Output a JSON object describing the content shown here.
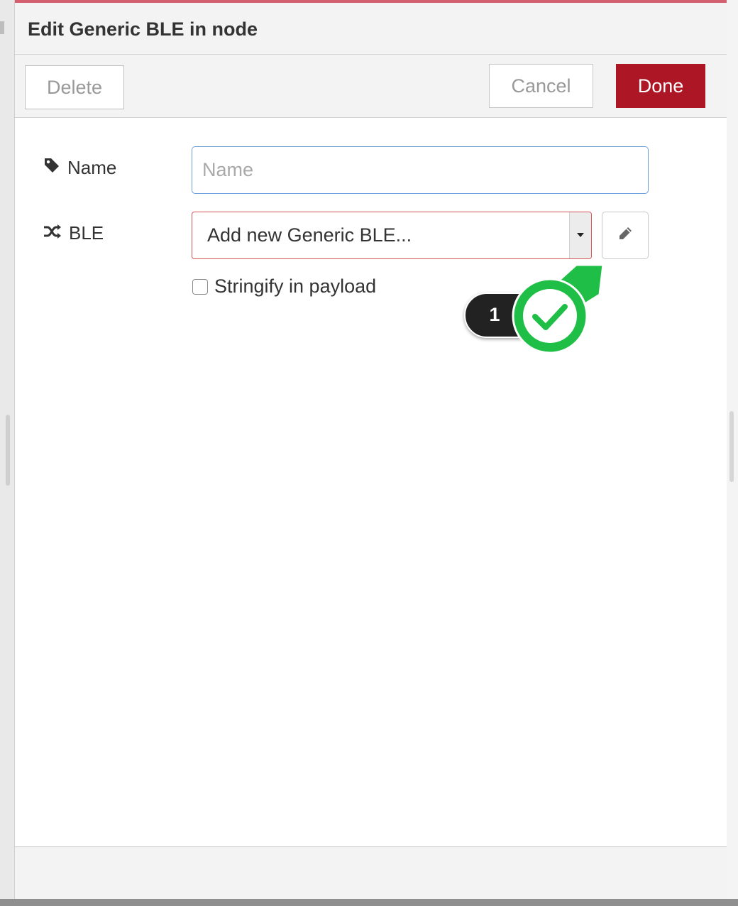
{
  "dialog": {
    "title": "Edit Generic BLE in node"
  },
  "toolbar": {
    "delete_label": "Delete",
    "cancel_label": "Cancel",
    "done_label": "Done"
  },
  "form": {
    "name": {
      "label": "Name",
      "icon": "tag-icon",
      "placeholder": "Name",
      "value": ""
    },
    "ble": {
      "label": "BLE",
      "icon": "random-icon",
      "selected": "Add new Generic BLE...",
      "edit_icon": "pencil-icon"
    },
    "stringify": {
      "label": "Stringify in payload",
      "checked": false
    }
  },
  "annotation": {
    "step_number": "1",
    "badge_icon": "checkmark-icon"
  },
  "colors": {
    "accent": "#ad1625",
    "top_accent": "#d45f6e",
    "error_border": "#d5545d",
    "focus_border": "#6d9fdb",
    "annotation_green": "#1fbf47"
  }
}
